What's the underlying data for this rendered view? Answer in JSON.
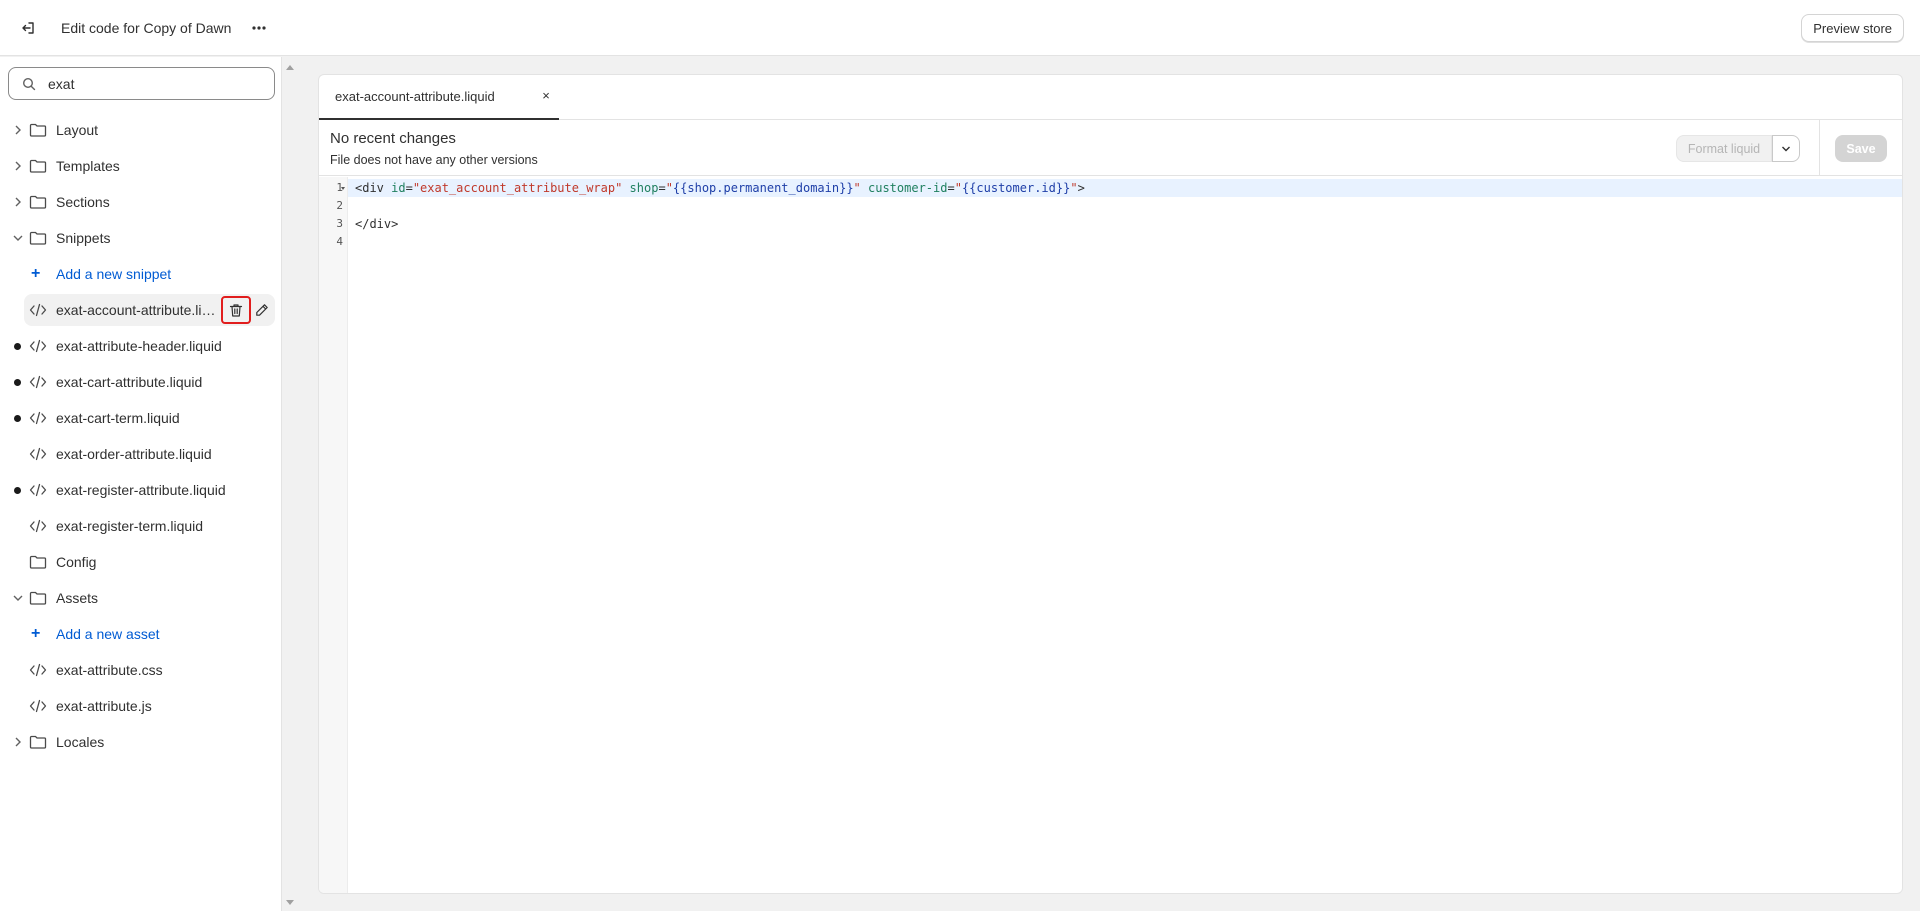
{
  "topbar": {
    "title": "Edit code for Copy of Dawn",
    "preview_label": "Preview store"
  },
  "sidebar": {
    "search_value": "exat",
    "tree": {
      "layout": "Layout",
      "templates": "Templates",
      "sections": "Sections",
      "snippets": "Snippets",
      "add_snippet": "Add a new snippet",
      "snippet_files": [
        "exat-account-attribute.liquid",
        "exat-attribute-header.liquid",
        "exat-cart-attribute.liquid",
        "exat-cart-term.liquid",
        "exat-order-attribute.liquid",
        "exat-register-attribute.liquid",
        "exat-register-term.liquid"
      ],
      "config": "Config",
      "assets": "Assets",
      "add_asset": "Add a new asset",
      "asset_files": [
        "exat-attribute.css",
        "exat-attribute.js"
      ],
      "locales": "Locales"
    }
  },
  "editor": {
    "tab_label": "exat-account-attribute.liquid",
    "tab_close": "×",
    "info_title": "No recent changes",
    "info_subtitle": "File does not have any other versions",
    "format_label": "Format liquid",
    "save_label": "Save",
    "line_numbers": [
      "1",
      "2",
      "3",
      "4"
    ],
    "code": {
      "l1_open": "<div ",
      "l1_attr_id": "id",
      "l1_eq1": "=",
      "l1_val_id": "\"exat_account_attribute_wrap\"",
      "l1_attr_shop": " shop",
      "l1_eq2": "=",
      "l1_q1": "\"",
      "l1_liq_shop": "{{shop.permanent_domain}}",
      "l1_q2": "\"",
      "l1_attr_cust": " customer-id",
      "l1_eq3": "=",
      "l1_q3": "\"",
      "l1_liq_cust": "{{customer.id}}",
      "l1_q4": "\"",
      "l1_close": ">",
      "l3": "</div>"
    }
  },
  "colors": {
    "accent_link": "#005bd3",
    "highlight_outline": "#e11d1d",
    "active_line": "#e8f2ff"
  }
}
